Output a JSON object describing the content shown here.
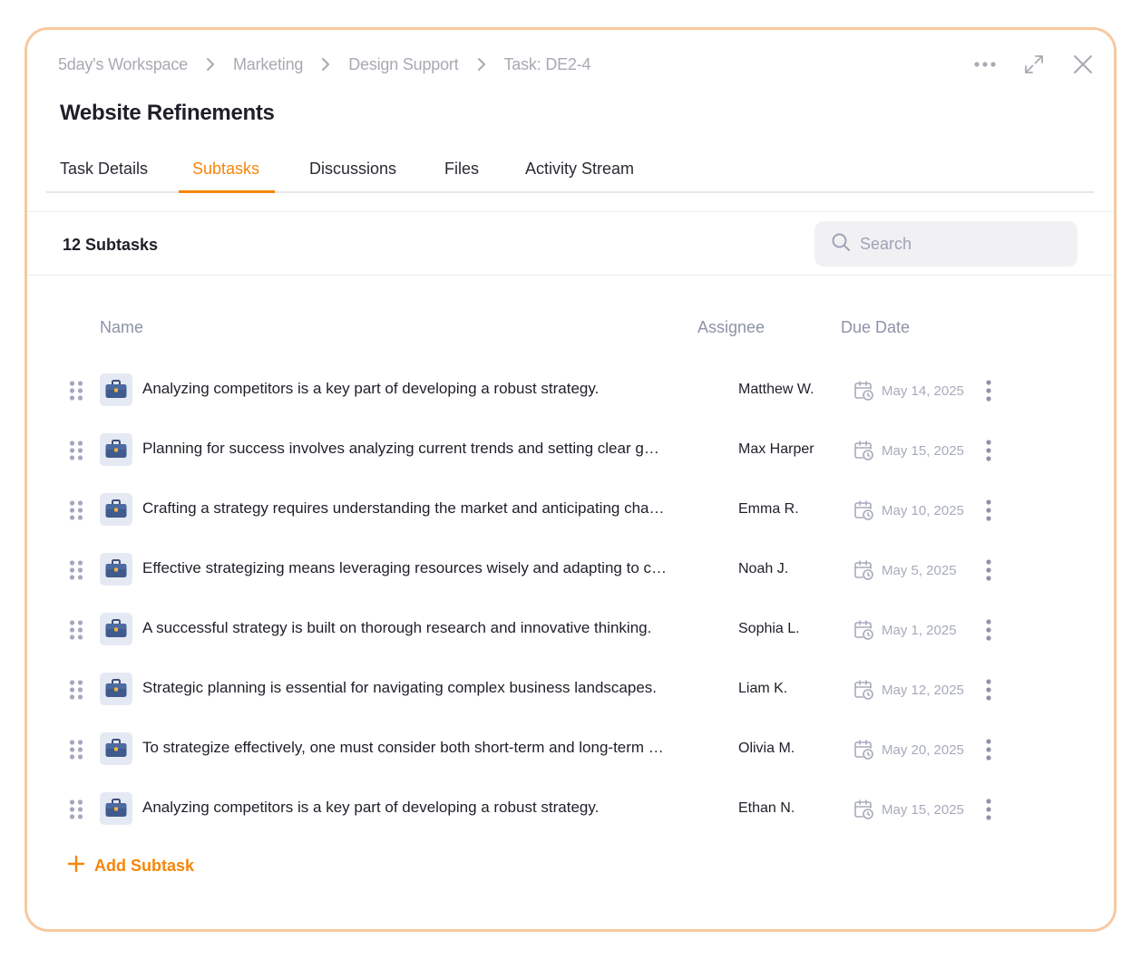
{
  "breadcrumb": [
    "5day's Workspace",
    "Marketing",
    "Design Support",
    "Task: DE2-4"
  ],
  "title": "Website Refinements",
  "tabs": [
    {
      "label": "Task Details",
      "active": false
    },
    {
      "label": "Subtasks",
      "active": true
    },
    {
      "label": "Discussions",
      "active": false
    },
    {
      "label": "Files",
      "active": false
    },
    {
      "label": "Activity Stream",
      "active": false
    }
  ],
  "subtasks_count": "12 Subtasks",
  "search": {
    "placeholder": "Search",
    "value": ""
  },
  "columns": {
    "name": "Name",
    "assignee": "Assignee",
    "due_date": "Due Date"
  },
  "rows": [
    {
      "name": "Analyzing competitors is a key part of developing a robust strategy.",
      "assignee": "Matthew W.",
      "due": "May 14, 2025"
    },
    {
      "name": "Planning for success involves analyzing current trends and setting clear goals.",
      "assignee": "Max Harper",
      "due": "May 15, 2025"
    },
    {
      "name": "Crafting a strategy requires understanding the market and anticipating changes.",
      "assignee": "Emma R.",
      "due": "May 10, 2025"
    },
    {
      "name": "Effective strategizing means leveraging resources wisely and adapting to change.",
      "assignee": "Noah J.",
      "due": "May 5, 2025"
    },
    {
      "name": "A successful strategy is built on thorough research and innovative thinking.",
      "assignee": "Sophia L.",
      "due": "May 1, 2025"
    },
    {
      "name": "Strategic planning is essential for navigating complex business landscapes.",
      "assignee": "Liam K.",
      "due": "May 12, 2025"
    },
    {
      "name": "To strategize effectively, one must consider both short-term and long-term goals.",
      "assignee": "Olivia M.",
      "due": "May 20, 2025"
    },
    {
      "name": "Analyzing competitors is a key part of developing a robust strategy.",
      "assignee": "Ethan N.",
      "due": "May 15, 2025"
    }
  ],
  "add_subtask_label": "Add Subtask",
  "icons": {
    "more": "more-horizontal-icon",
    "expand": "expand-icon",
    "close": "close-icon",
    "search": "search-icon",
    "drag": "drag-handle-icon",
    "task": "briefcase-icon",
    "calendar": "calendar-clock-icon",
    "row_menu": "more-vertical-icon",
    "add": "plus-icon"
  },
  "colors": {
    "accent": "#f5860a",
    "panel_border": "#f8c9a0",
    "muted": "#a9a9b2"
  }
}
